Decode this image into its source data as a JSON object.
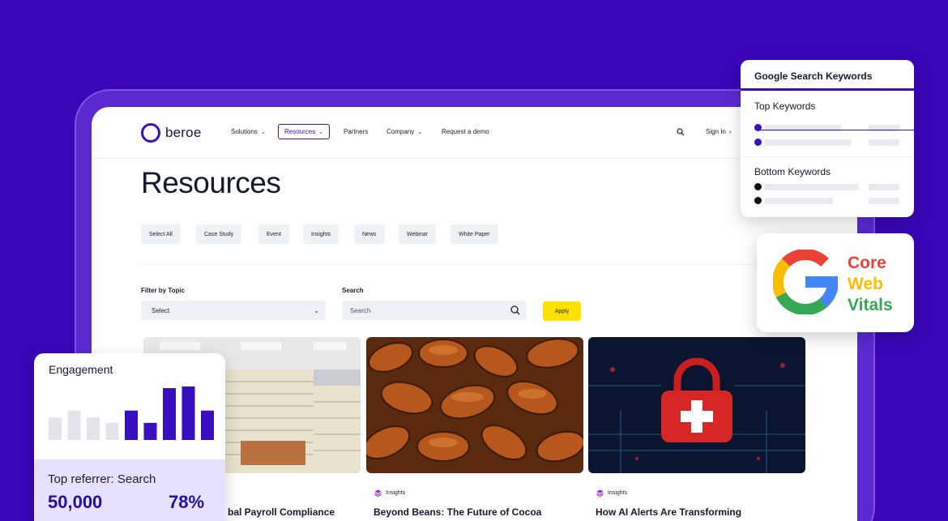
{
  "nav": {
    "logo": "beroe",
    "items": [
      "Solutions",
      "Resources",
      "Partners",
      "Company",
      "Request a demo"
    ],
    "signin": "Sign In"
  },
  "page": {
    "title": "Resources",
    "chips": [
      "Select All",
      "Case Study",
      "Event",
      "Insights",
      "News",
      "Webinar",
      "White Paper"
    ],
    "filter_label": "Filter by Topic",
    "filter_value": "Select",
    "search_label": "Search",
    "search_placeholder": "Search",
    "apply": "Apply"
  },
  "cards": [
    {
      "tag": "",
      "title": "bal Payroll Compliance"
    },
    {
      "tag": "Insights",
      "title": "Beyond Beans: The Future of Cocoa"
    },
    {
      "tag": "Insights",
      "title": "How AI Alerts Are Transforming"
    }
  ],
  "engagement": {
    "title": "Engagement",
    "bars": [
      {
        "value": 0.42,
        "color": "#e3e4ea"
      },
      {
        "value": 0.55,
        "color": "#e3e4ea"
      },
      {
        "value": 0.42,
        "color": "#e3e4ea"
      },
      {
        "value": 0.32,
        "color": "#e3e4ea"
      },
      {
        "value": 0.55,
        "color": "#3a0fbf"
      },
      {
        "value": 0.32,
        "color": "#3a0fbf"
      },
      {
        "value": 0.97,
        "color": "#3a0fbf"
      },
      {
        "value": 1.0,
        "color": "#3a0fbf"
      },
      {
        "value": 0.55,
        "color": "#3a0fbf"
      }
    ],
    "referrer": "Top referrer: Search",
    "count": "50,000",
    "percent": "78%"
  },
  "keywords": {
    "title": "Google Search Keywords",
    "top_label": "Top Keywords",
    "bottom_label": "Bottom Keywords"
  },
  "vitals": {
    "line1": "Core",
    "line2": "Web",
    "line3": "Vitals",
    "colors": {
      "core": "#ea4335",
      "web": "#fbbc04",
      "vitals": "#34a853"
    }
  },
  "colors": {
    "background": "#3a06b8",
    "accent": "#3a0fbf",
    "apply": "#ffe100"
  }
}
